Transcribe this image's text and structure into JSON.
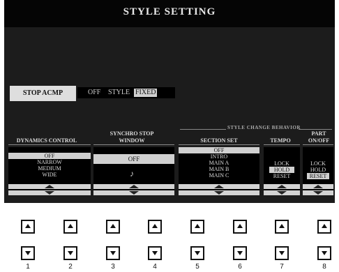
{
  "title": "STYLE SETTING",
  "stop_acmp": {
    "label": "STOP ACMP",
    "options": [
      "OFF",
      "STYLE",
      "FIXED"
    ],
    "selected": "FIXED"
  },
  "style_change_behavior": "STYLE CHANGE BEHAVIOR",
  "columns": {
    "dynamics": {
      "label": "DYNAMICS CONTROL",
      "items": [
        "OFF",
        "NARROW",
        "MEDIUM",
        "WIDE"
      ],
      "selected": "OFF"
    },
    "synchro_stop": {
      "label_line1": "SYNCHRO STOP",
      "label_line2": "WINDOW",
      "value": "OFF",
      "note_icon": "eighth-note-icon"
    },
    "section_set": {
      "label": "SECTION SET",
      "items": [
        "OFF",
        "INTRO",
        "MAIN A",
        "MAIN B",
        "MAIN C"
      ],
      "selected": "OFF"
    },
    "tempo": {
      "label": "TEMPO",
      "items": [
        "LOCK",
        "HOLD",
        "RESET"
      ],
      "selected": "HOLD"
    },
    "part_onoff": {
      "label_line1": "PART",
      "label_line2": "ON/OFF",
      "items": [
        "LOCK",
        "HOLD",
        "RESET"
      ],
      "selected": "RESET"
    }
  },
  "hardware_buttons": [
    "1",
    "2",
    "3",
    "4",
    "5",
    "6",
    "7",
    "8"
  ],
  "colors": {
    "screen_bg": "#1c1c1c",
    "title_bg": "#050505",
    "highlight": "#d0d0d0"
  }
}
